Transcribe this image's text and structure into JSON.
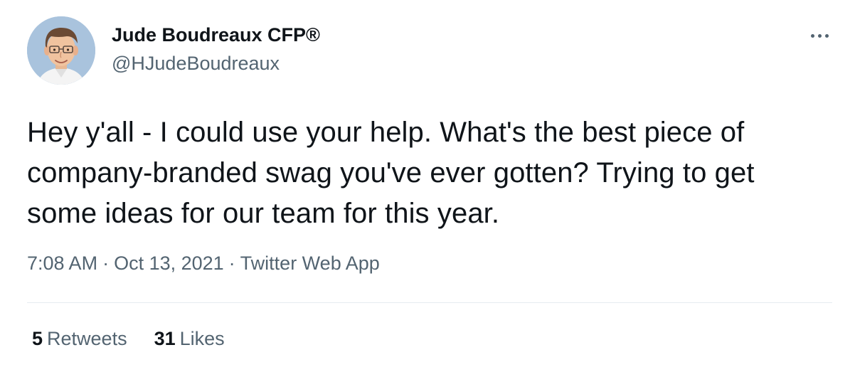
{
  "user": {
    "display_name": "Jude Boudreaux CFP®",
    "handle": "@HJudeBoudreaux"
  },
  "tweet": {
    "text": "Hey y'all - I could use your help. What's the best piece of company-branded swag you've ever gotten? Trying to get some ideas for our team for this year.",
    "time": "7:08 AM",
    "date": "Oct 13, 2021",
    "source": "Twitter Web App",
    "separator": "·"
  },
  "stats": {
    "retweets_count": "5",
    "retweets_label": "Retweets",
    "likes_count": "31",
    "likes_label": "Likes"
  },
  "icons": {
    "more": "more-horizontal-icon"
  },
  "colors": {
    "text_primary": "#0f1419",
    "text_secondary": "#536471",
    "divider": "#e6ecf0",
    "avatar_bg": "#a9c3dd"
  }
}
